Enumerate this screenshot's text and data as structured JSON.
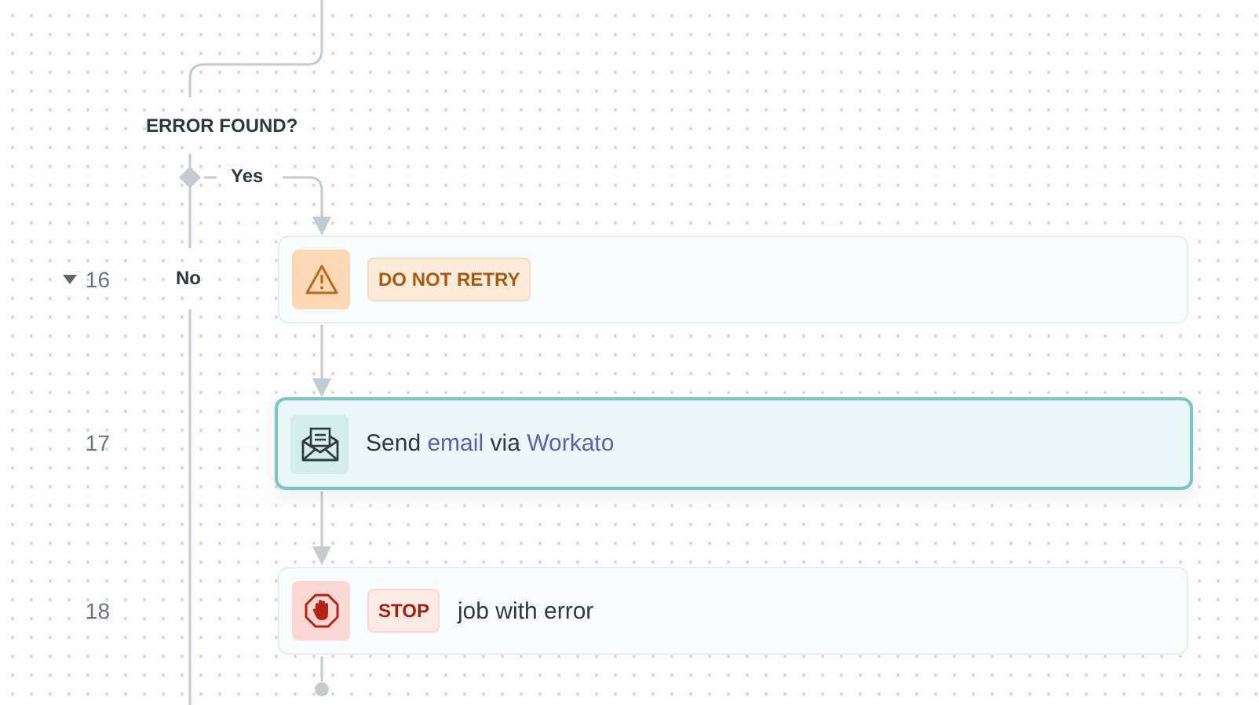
{
  "condition": {
    "label": "ERROR FOUND?",
    "yes_label": "Yes",
    "no_label": "No"
  },
  "steps": [
    {
      "number": "16",
      "expanded": true,
      "kind": "warning",
      "selected": false,
      "badge": "DO NOT RETRY"
    },
    {
      "number": "17",
      "kind": "email",
      "selected": true,
      "parts": [
        {
          "text": "Send",
          "link": false
        },
        {
          "text": "email",
          "link": true
        },
        {
          "text": "via",
          "link": false
        },
        {
          "text": "Workato",
          "link": true
        }
      ]
    },
    {
      "number": "18",
      "kind": "stop",
      "selected": false,
      "badge": "STOP",
      "parts": [
        {
          "text": "job with error",
          "link": false
        }
      ]
    }
  ]
}
